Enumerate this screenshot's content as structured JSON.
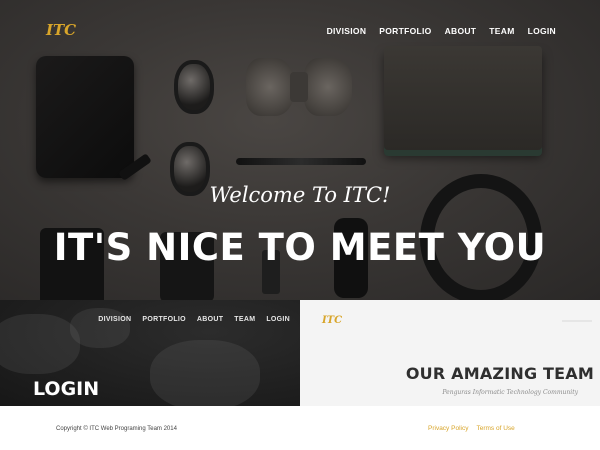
{
  "hero": {
    "logo": "ITC",
    "nav": [
      "DIVISION",
      "PORTFOLIO",
      "ABOUT",
      "TEAM",
      "LOGIN"
    ],
    "welcome": "Welcome To ITC!",
    "headline": "IT'S NICE TO MEET YOU"
  },
  "login_panel": {
    "nav": [
      "DIVISION",
      "PORTFOLIO",
      "ABOUT",
      "TEAM",
      "LOGIN"
    ],
    "title": "LOGIN"
  },
  "team_panel": {
    "logo": "ITC",
    "title": "OUR AMAZING TEAM",
    "subtitle": "Penguras Informatic Technology Community"
  },
  "footer": {
    "copyright": "Copyright © ITC Web Programing Team 2014",
    "links": [
      "Privacy Policy",
      "Terms of Use"
    ]
  },
  "colors": {
    "accent": "#d8a52a",
    "hero_bg": "#3a3735",
    "login_bg": "#1f1f1f",
    "team_bg": "#f4f4f4"
  }
}
